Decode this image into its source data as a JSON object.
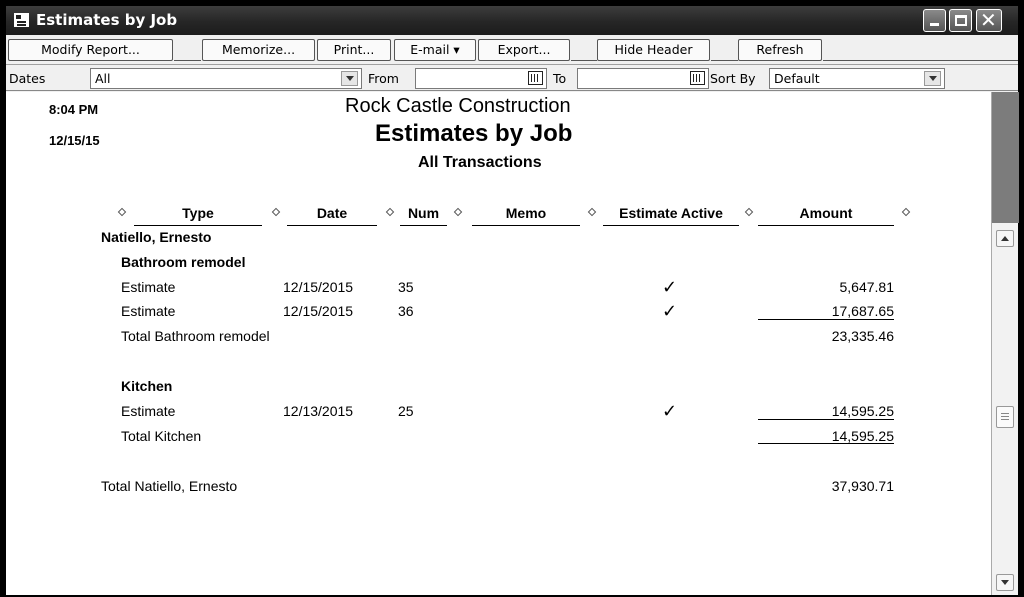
{
  "window": {
    "title": "Estimates by Job"
  },
  "toolbar": {
    "modify_report": "Modify Report...",
    "memorize": "Memorize...",
    "print": "Print...",
    "email": "E-mail ▾",
    "export": "Export...",
    "hide_header": "Hide Header",
    "refresh": "Refresh"
  },
  "filters": {
    "dates_label": "Dates",
    "dates_value": "All",
    "from_label": "From",
    "from_value": "",
    "to_label": "To",
    "to_value": "",
    "sort_by_label": "Sort By",
    "sort_by_value": "Default"
  },
  "report": {
    "time": "8:04 PM",
    "date": "12/15/15",
    "company": "Rock Castle Construction",
    "title": "Estimates by Job",
    "subtitle": "All Transactions",
    "columns": {
      "type": "Type",
      "date": "Date",
      "num": "Num",
      "memo": "Memo",
      "estimate_active": "Estimate Active",
      "amount": "Amount"
    },
    "customer": "Natiello, Ernesto",
    "jobs": [
      {
        "name": "Bathroom remodel",
        "rows": [
          {
            "type": "Estimate",
            "date": "12/15/2015",
            "num": "35",
            "memo": "",
            "active": "✓",
            "amount": "5,647.81"
          },
          {
            "type": "Estimate",
            "date": "12/15/2015",
            "num": "36",
            "memo": "",
            "active": "✓",
            "amount": "17,687.65"
          }
        ],
        "total_label": "Total Bathroom remodel",
        "total_amount": "23,335.46"
      },
      {
        "name": "Kitchen",
        "rows": [
          {
            "type": "Estimate",
            "date": "12/13/2015",
            "num": "25",
            "memo": "",
            "active": "✓",
            "amount": "14,595.25"
          }
        ],
        "total_label": "Total Kitchen",
        "total_amount": "14,595.25"
      }
    ],
    "customer_total_label": "Total Natiello, Ernesto",
    "customer_total_amount": "37,930.71"
  }
}
